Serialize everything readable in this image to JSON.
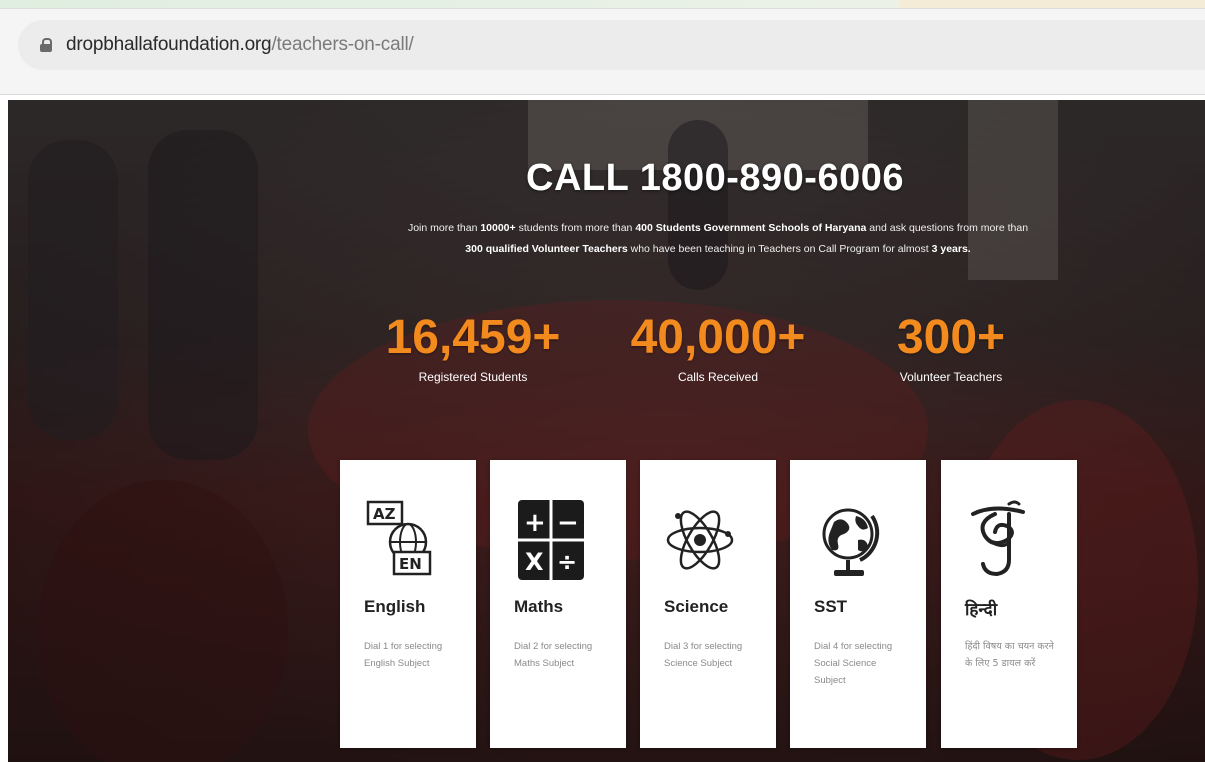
{
  "browser": {
    "url_domain": "dropbhallafoundation.org",
    "url_path": "/teachers-on-call/"
  },
  "hero": {
    "headline": "CALL 1800-890-6006",
    "intro_parts": [
      "Join more than ",
      "10000+",
      " students from more than ",
      "400 Students Government Schools of Haryana",
      " and ask questions from more than ",
      "300 qualified Volunteer Teachers",
      " who have been teaching in Teachers on Call Program for almost ",
      "3 years."
    ]
  },
  "stats": [
    {
      "value": "16,459+",
      "label": "Registered Students"
    },
    {
      "value": "40,000+",
      "label": "Calls Received"
    },
    {
      "value": "300+",
      "label": "Volunteer Teachers"
    }
  ],
  "subjects": [
    {
      "icon": "translate-icon",
      "title": "English",
      "desc": "Dial 1 for selecting English Subject"
    },
    {
      "icon": "calculator-icon",
      "title": "Maths",
      "desc": "Dial 2 for selecting Maths Subject"
    },
    {
      "icon": "atom-icon",
      "title": "Science",
      "desc": "Dial 3 for selecting Science Subject"
    },
    {
      "icon": "globe-icon",
      "title": "SST",
      "desc": "Dial 4 for selecting Social Science Subject"
    },
    {
      "icon": "shri-icon",
      "title": "हिन्दी",
      "desc": "हिंदी विषय का चयन करने के लिए 5 डायल करें"
    }
  ],
  "colors": {
    "accent_orange": "#f28a1e",
    "card_bg": "#ffffff"
  }
}
